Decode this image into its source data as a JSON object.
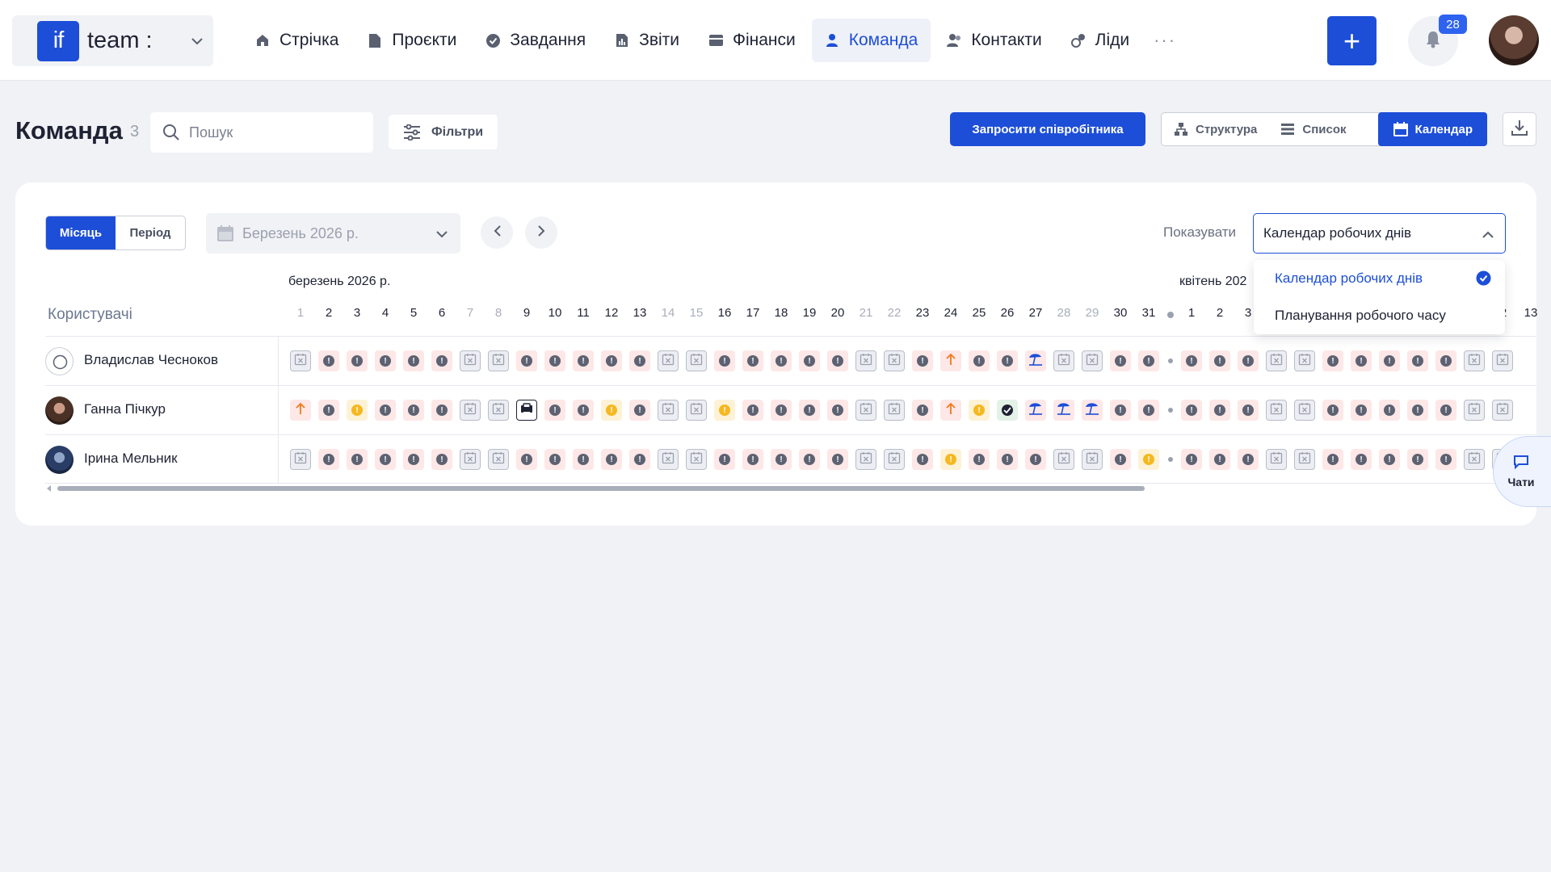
{
  "brand": {
    "logo_text": "if",
    "name": "team :",
    "caret_icon": "chevron-down-icon"
  },
  "nav": {
    "items": [
      {
        "label": "Стрічка",
        "icon": "home-icon",
        "active": false
      },
      {
        "label": "Проєкти",
        "icon": "document-icon",
        "active": false
      },
      {
        "label": "Завдання",
        "icon": "check-circle-icon",
        "active": false
      },
      {
        "label": "Звіти",
        "icon": "report-icon",
        "active": false
      },
      {
        "label": "Фінанси",
        "icon": "wallet-icon",
        "active": false
      },
      {
        "label": "Команда",
        "icon": "user-icon",
        "active": true
      },
      {
        "label": "Контакти",
        "icon": "contacts-icon",
        "active": false
      },
      {
        "label": "Ліди",
        "icon": "leads-icon",
        "active": false
      }
    ],
    "more_label": "···"
  },
  "header_actions": {
    "add_label": "+",
    "notifications_count": "28"
  },
  "page": {
    "title": "Команда",
    "count": "3",
    "search_placeholder": "Пошук",
    "filters_label": "Фільтри",
    "invite_label": "Запросити співробітника",
    "views": [
      {
        "label": "Структура",
        "icon": "structure-icon",
        "active": false
      },
      {
        "label": "Список",
        "icon": "list-icon",
        "active": false
      },
      {
        "label": "Календар",
        "icon": "calendar-icon",
        "active": true
      }
    ]
  },
  "calendar": {
    "mode_tabs": [
      {
        "label": "Місяць",
        "active": true
      },
      {
        "label": "Період",
        "active": false
      }
    ],
    "month_picker_value": "Березень 2026 р.",
    "show_label": "Показувати",
    "show_value": "Календар робочих днів",
    "show_options": [
      {
        "label": "Календар робочих днів",
        "selected": true
      },
      {
        "label": "Планування робочого часу",
        "selected": false
      }
    ],
    "users_header": "Користувачі",
    "month1_label": "березень 2026 р.",
    "month2_label": "квітень 202",
    "march_days": [
      1,
      2,
      3,
      4,
      5,
      6,
      7,
      8,
      9,
      10,
      11,
      12,
      13,
      14,
      15,
      16,
      17,
      18,
      19,
      20,
      21,
      22,
      23,
      24,
      25,
      26,
      27,
      28,
      29,
      30,
      31
    ],
    "march_weekends": [
      1,
      7,
      8,
      14,
      15,
      21,
      22,
      28,
      29
    ],
    "april_days": [
      1,
      2,
      3
    ],
    "april_tail_days": [
      2,
      13
    ],
    "users": [
      {
        "name": "Владислав Чесноков",
        "avatar": "ava1",
        "march": [
          "off",
          "abs",
          "abs",
          "abs",
          "abs",
          "abs",
          "off",
          "off",
          "abs",
          "abs",
          "abs",
          "abs",
          "abs",
          "off",
          "off",
          "abs",
          "abs",
          "abs",
          "abs",
          "abs",
          "off",
          "off",
          "abs",
          "late",
          "abs",
          "abs",
          "vac",
          "off",
          "off",
          "abs",
          "abs"
        ],
        "april": [
          "abs",
          "abs",
          "abs",
          "off",
          "off",
          "abs",
          "abs",
          "abs",
          "abs",
          "abs",
          "off",
          "off"
        ]
      },
      {
        "name": "Ганна Пічкур",
        "avatar": "ava2",
        "march": [
          "late",
          "abs",
          "sick",
          "abs",
          "abs",
          "abs",
          "off",
          "off",
          "rem",
          "abs",
          "abs",
          "sick",
          "abs",
          "off",
          "off",
          "sick",
          "abs",
          "abs",
          "abs",
          "abs",
          "off",
          "off",
          "abs",
          "late",
          "sick",
          "ok",
          "vac",
          "vac",
          "vac",
          "abs",
          "abs"
        ],
        "april": [
          "abs",
          "abs",
          "abs",
          "off",
          "off",
          "abs",
          "abs",
          "abs",
          "abs",
          "abs",
          "off",
          "off"
        ]
      },
      {
        "name": "Ірина Мельник",
        "avatar": "ava3",
        "march": [
          "off",
          "abs",
          "abs",
          "abs",
          "abs",
          "abs",
          "off",
          "off",
          "abs",
          "abs",
          "abs",
          "abs",
          "abs",
          "off",
          "off",
          "abs",
          "abs",
          "abs",
          "abs",
          "abs",
          "off",
          "off",
          "abs",
          "sick",
          "abs",
          "abs",
          "abs",
          "off",
          "off",
          "abs",
          "sick"
        ],
        "april": [
          "abs",
          "abs",
          "abs",
          "off",
          "off",
          "abs",
          "abs",
          "abs",
          "abs",
          "abs",
          "off",
          "off"
        ]
      }
    ]
  },
  "chat": {
    "label": "Чати"
  },
  "colors": {
    "accent": "#1d4ed8",
    "absence": "#fde7e7",
    "sick": "#f5b820",
    "ok": "#e3f2e6"
  }
}
